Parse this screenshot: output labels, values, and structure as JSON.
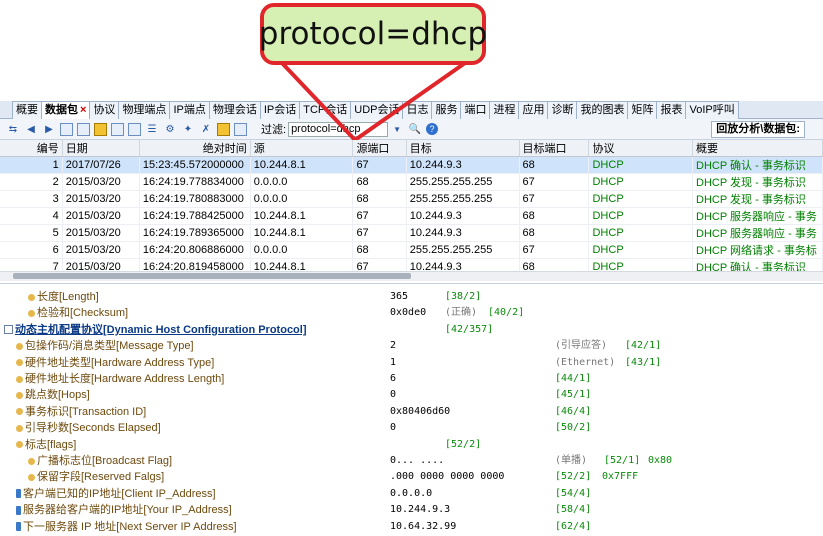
{
  "callout": {
    "text": "protocol=dhcp"
  },
  "tabs": [
    "概要",
    "数据包",
    "协议",
    "物理端点",
    "IP端点",
    "物理会话",
    "IP会话",
    "TCP会话",
    "UDP会话",
    "日志",
    "服务",
    "端口",
    "进程",
    "应用",
    "诊断",
    "我的图表",
    "矩阵",
    "报表",
    "VoIP呼叫"
  ],
  "active_tab_close": "×",
  "toolbar": {
    "filter_label": "过滤:",
    "filter_value": "protocol=dhcp",
    "replay_label": "回放分析\\数据包:"
  },
  "table": {
    "columns": [
      "编号",
      "日期",
      "绝对时间",
      "源",
      "源端口",
      "目标",
      "目标端口",
      "协议",
      "概要"
    ],
    "rows": [
      [
        "1",
        "2017/07/26",
        "15:23:45.572000000",
        "10.244.8.1",
        "67",
        "10.244.9.3",
        "68",
        "DHCP",
        "DHCP 确认 - 事务标识"
      ],
      [
        "2",
        "2015/03/20",
        "16:24:19.778834000",
        "0.0.0.0",
        "68",
        "255.255.255.255",
        "67",
        "DHCP",
        "DHCP 发现 - 事务标识"
      ],
      [
        "3",
        "2015/03/20",
        "16:24:19.780883000",
        "0.0.0.0",
        "68",
        "255.255.255.255",
        "67",
        "DHCP",
        "DHCP 发现 - 事务标识"
      ],
      [
        "4",
        "2015/03/20",
        "16:24:19.788425000",
        "10.244.8.1",
        "67",
        "10.244.9.3",
        "68",
        "DHCP",
        "DHCP 服务器响应 - 事务"
      ],
      [
        "5",
        "2015/03/20",
        "16:24:19.789365000",
        "10.244.8.1",
        "67",
        "10.244.9.3",
        "68",
        "DHCP",
        "DHCP 服务器响应 - 事务"
      ],
      [
        "6",
        "2015/03/20",
        "16:24:20.806886000",
        "0.0.0.0",
        "68",
        "255.255.255.255",
        "67",
        "DHCP",
        "DHCP 网络请求 - 事务标"
      ],
      [
        "7",
        "2015/03/20",
        "16:24:20.819458000",
        "10.244.8.1",
        "67",
        "10.244.9.3",
        "68",
        "DHCP",
        "DHCP 确认 - 事务标识"
      ]
    ]
  },
  "details": [
    {
      "name": "长度[Length]",
      "value": "365",
      "note": "",
      "offset": "[38/2]",
      "extra": ""
    },
    {
      "name": "检验和[Checksum]",
      "value": "0x0de0",
      "note": "(正确)",
      "offset": "[40/2]",
      "extra": ""
    },
    {
      "name": "动态主机配置协议[Dynamic Host Configuration Protocol]",
      "value": "",
      "note": "",
      "offset": "[42/357]",
      "extra": ""
    },
    {
      "name": "包操作码/消息类型[Message Type]",
      "value": "2",
      "note": "(引导应答)",
      "offset": "[42/1]",
      "extra": ""
    },
    {
      "name": "硬件地址类型[Hardware Address Type]",
      "value": "1",
      "note": "(Ethernet)",
      "offset": "[43/1]",
      "extra": ""
    },
    {
      "name": "硬件地址长度[Hardware Address Length]",
      "value": "6",
      "note": "",
      "offset": "[44/1]",
      "extra": ""
    },
    {
      "name": "跳点数[Hops]",
      "value": "0",
      "note": "",
      "offset": "[45/1]",
      "extra": ""
    },
    {
      "name": "事务标识[Transaction ID]",
      "value": "0x80406d60",
      "note": "",
      "offset": "[46/4]",
      "extra": ""
    },
    {
      "name": "引导秒数[Seconds Elapsed]",
      "value": "0",
      "note": "",
      "offset": "[50/2]",
      "extra": ""
    },
    {
      "name": "标志[flags]",
      "value": "",
      "note": "",
      "offset": "[52/2]",
      "extra": ""
    },
    {
      "name": "广播标志位[Broadcast Flag]",
      "value": "0... ....",
      "note": "(单播)",
      "offset": "[52/1]",
      "extra": "0x80"
    },
    {
      "name": "保留字段[Reserved Falgs]",
      "value": ".000 0000 0000 0000",
      "note": "",
      "offset": "[52/2]",
      "extra": "0x7FFF"
    },
    {
      "name": "客户端已知的IP地址[Client IP_Address]",
      "value": "0.0.0.0",
      "note": "",
      "offset": "[54/4]",
      "extra": ""
    },
    {
      "name": "服务器给客户端的IP地址[Your IP_Address]",
      "value": "10.244.9.3",
      "note": "",
      "offset": "[58/4]",
      "extra": ""
    },
    {
      "name": "下一服务器 IP 地址[Next Server IP Address]",
      "value": "10.64.32.99",
      "note": "",
      "offset": "[62/4]",
      "extra": ""
    }
  ]
}
